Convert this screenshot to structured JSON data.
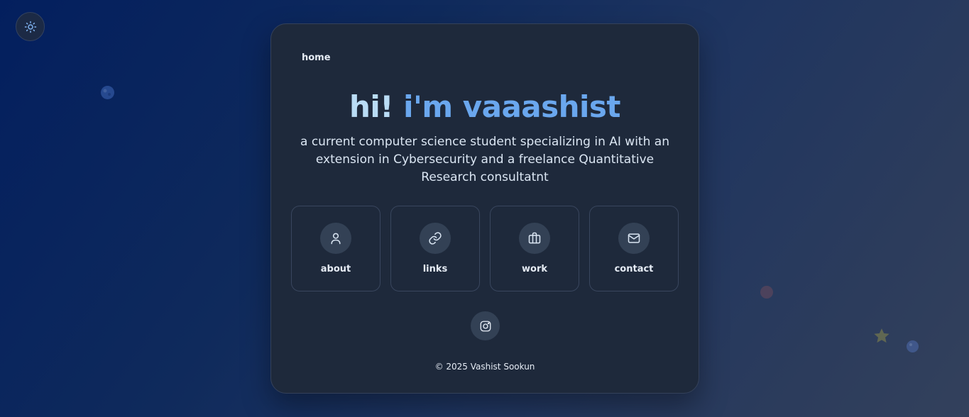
{
  "theme_toggle": {
    "icon": "sun-icon"
  },
  "nav": {
    "home": "home"
  },
  "hero": {
    "greeting": "hi!",
    "name": "i'm vaaashist",
    "subtitle": "a current computer science student specializing in AI with an extension in Cybersecurity and a freelance Quantitative Research consultatnt"
  },
  "tiles": [
    {
      "label": "about",
      "icon": "user-icon"
    },
    {
      "label": "links",
      "icon": "link-icon"
    },
    {
      "label": "work",
      "icon": "briefcase-icon"
    },
    {
      "label": "contact",
      "icon": "mail-icon"
    }
  ],
  "social": {
    "instagram_icon": "instagram-icon"
  },
  "footer": {
    "copyright": "© 2025 Vashist Sookun"
  },
  "colors": {
    "card_bg": "#1e293b",
    "accent": "#6aa7ee",
    "greeting": "#b9dcf5",
    "icon_bg": "#334155"
  }
}
